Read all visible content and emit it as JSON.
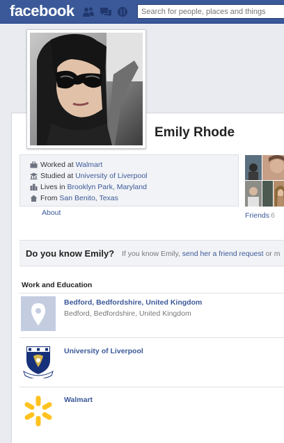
{
  "topbar": {
    "logo": "facebook",
    "search_placeholder": "Search for people, places and things"
  },
  "profile": {
    "name": "Emily Rhode"
  },
  "intro": {
    "worked_prefix": "Worked at",
    "worked_place": "Walmart",
    "studied_prefix": "Studied at",
    "studied_place": "University of Liverpool",
    "lives_prefix": "Lives in",
    "lives_place": "Brooklyn Park, Maryland",
    "from_prefix": "From",
    "from_place": "San Benito, Texas",
    "about_link": "About"
  },
  "friends": {
    "label": "Friends",
    "count": "6"
  },
  "know_bar": {
    "question": "Do you know Emily?",
    "text_prefix": "If you know Emily,",
    "link": "send her a friend request",
    "text_suffix": "or m"
  },
  "work_education": {
    "title": "Work and Education",
    "items": [
      {
        "title": "Bedford, Bedfordshire, United Kingdom",
        "subtitle": "Bedford, Bedfordshire, United Kingdom",
        "icon": "location-pin-icon"
      },
      {
        "title": "University of Liverpool",
        "icon": "university-crest-icon"
      },
      {
        "title": "Walmart",
        "icon": "walmart-spark-icon"
      }
    ]
  },
  "colors": {
    "brand_blue": "#3b5998",
    "link_blue": "#3b5998",
    "walmart_yellow": "#ffc220",
    "crest_blue": "#16307a"
  }
}
